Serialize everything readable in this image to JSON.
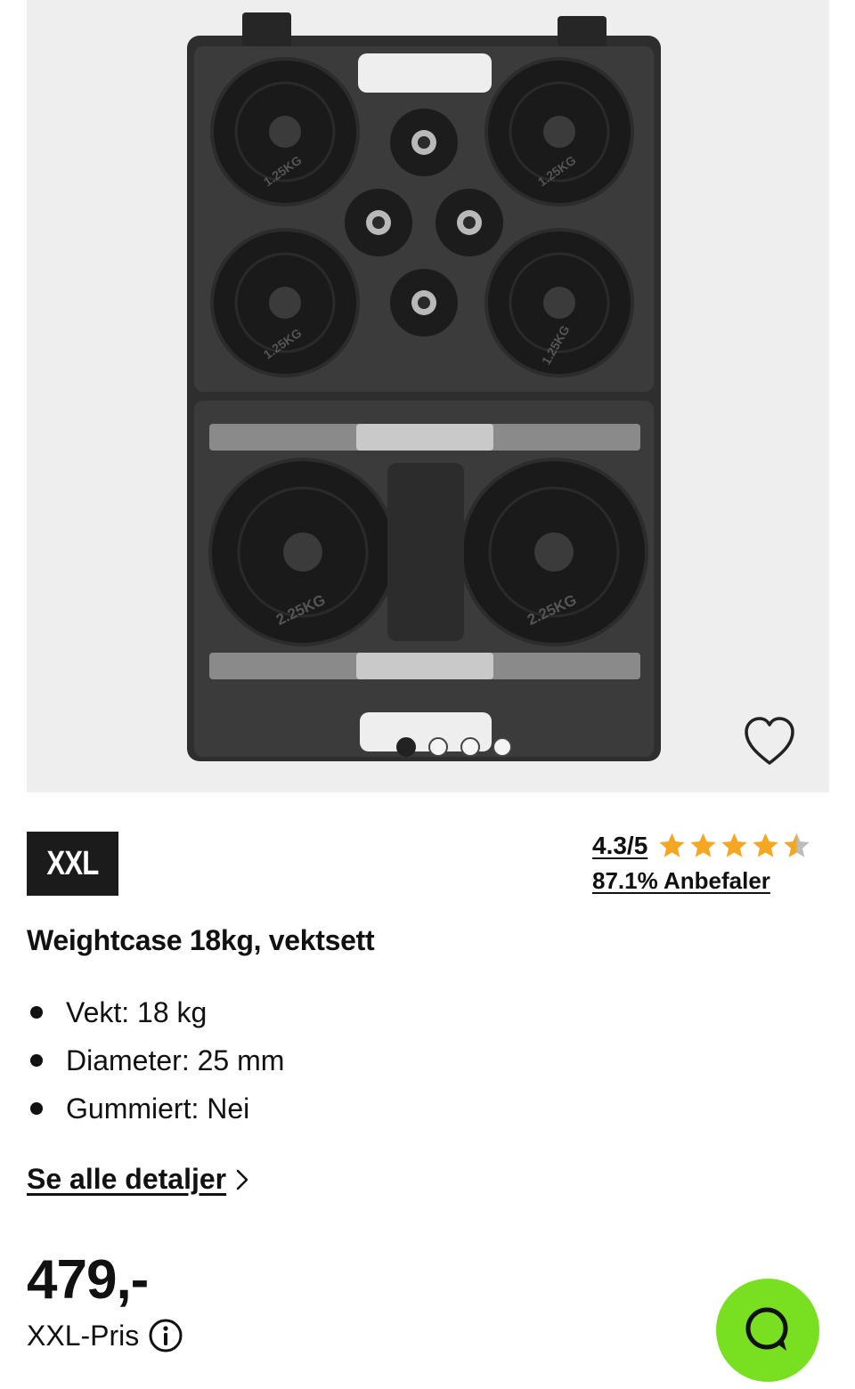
{
  "gallery": {
    "image_alt": "Weightcase 18kg, vektsett",
    "plate_labels": [
      "1.25KG",
      "1.25KG",
      "1.25KG",
      "1.25KG",
      "2.25KG",
      "2.25KG"
    ],
    "slide_count": 4,
    "active_slide": 1
  },
  "brand": {
    "logo_text": "XXL"
  },
  "rating": {
    "value": "4.3/5",
    "stars": 4.3,
    "star_color": "#f5a623",
    "recommend": "87.1% Anbefaler"
  },
  "product": {
    "title": "Weightcase 18kg, vektsett",
    "specs": [
      {
        "text": "Vekt: 18 kg"
      },
      {
        "text": "Diameter: 25 mm"
      },
      {
        "text": "Gummiert: Nei"
      }
    ]
  },
  "details_link": {
    "label": "Se alle detaljer"
  },
  "price": {
    "amount": "479,-",
    "label": "XXL-Pris"
  },
  "chat": {
    "button_color": "#79e021",
    "icon": "chat-icon"
  }
}
